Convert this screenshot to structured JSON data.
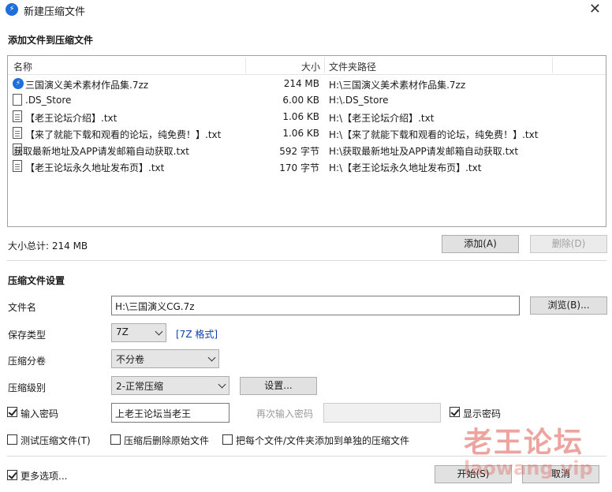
{
  "window": {
    "title": "新建压缩文件",
    "close_icon": "close-icon"
  },
  "add_section": {
    "title": "添加文件到压缩文件",
    "columns": [
      "名称",
      "大小",
      "文件夹路径"
    ],
    "files": [
      {
        "icon": "7z-file-icon",
        "name": "三国演义美术素材作品集.7zz",
        "size": "214 MB",
        "path": "H:\\三国演义美术素材作品集.7zz"
      },
      {
        "icon": "file-icon",
        "name": ".DS_Store",
        "size": "6.00 KB",
        "path": "H:\\.DS_Store"
      },
      {
        "icon": "text-file-icon",
        "name": "【老王论坛介绍】.txt",
        "size": "1.06 KB",
        "path": "H:\\【老王论坛介绍】.txt"
      },
      {
        "icon": "text-file-icon",
        "name": "【来了就能下载和观看的论坛，纯免费！】.txt",
        "size": "1.06 KB",
        "path": "H:\\【来了就能下载和观看的论坛，纯免费！】.txt"
      },
      {
        "icon": "text-file-icon",
        "name": "获取最新地址及APP请发邮箱自动获取.txt",
        "size": "592 字节",
        "path": "H:\\获取最新地址及APP请发邮箱自动获取.txt"
      },
      {
        "icon": "text-file-icon",
        "name": "【老王论坛永久地址发布页】.txt",
        "size": "170 字节",
        "path": "H:\\【老王论坛永久地址发布页】.txt"
      }
    ],
    "total_size": "大小总计: 214 MB",
    "add_button": "添加(A)",
    "delete_button": "删除(D)"
  },
  "settings": {
    "title": "压缩文件设置",
    "filename_label": "文件名",
    "filename_value": "H:\\三国演义CG.7z",
    "browse_button": "浏览(B)...",
    "type_label": "保存类型",
    "type_value": "7Z",
    "type_link": "[7Z 格式]",
    "split_label": "压缩分卷",
    "split_value": "不分卷",
    "level_label": "压缩级别",
    "level_value": "2-正常压缩",
    "level_settings_button": "设置...",
    "password_checkbox": "输入密码",
    "password_checked": true,
    "password_value": "上老王论坛当老王",
    "reenter_label": "再次输入密码",
    "reenter_value": "",
    "show_password_checkbox": "显示密码",
    "show_password_checked": true,
    "test_checkbox": "测试压缩文件(T)",
    "delete_after_checkbox": "压缩后删除原始文件",
    "each_separate_checkbox": "把每个文件/文件夹添加到单独的压缩文件"
  },
  "footer": {
    "more_options_checkbox": "更多选项...",
    "more_options_checked": true,
    "start_button": "开始(S)",
    "cancel_button": "取消"
  },
  "watermark": {
    "text": "老王论坛",
    "sub": "laowang.vip"
  }
}
